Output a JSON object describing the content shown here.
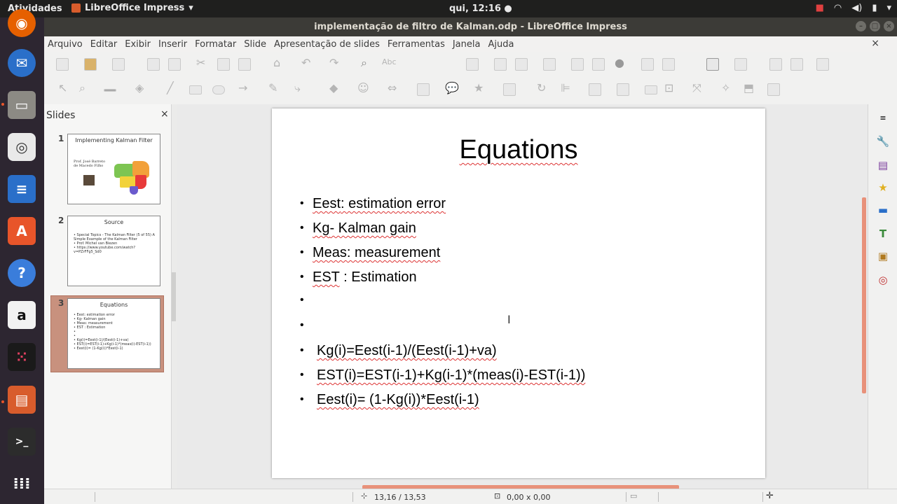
{
  "topbar": {
    "activities": "Atividades",
    "app_menu": "LibreOffice Impress",
    "clock": "qui, 12:16 ●"
  },
  "window": {
    "title": "implementação de filtro de Kalman.odp - LibreOffice Impress"
  },
  "menu": [
    "Arquivo",
    "Editar",
    "Exibir",
    "Inserir",
    "Formatar",
    "Slide",
    "Apresentação de slides",
    "Ferramentas",
    "Janela",
    "Ajuda"
  ],
  "slides_pane": {
    "header": "Slides",
    "close": "×",
    "thumbnails": [
      {
        "num": "1",
        "title": "Implementing Kalman Filter",
        "lines": [
          "Prof. José Barreto",
          "de Macedo Filho"
        ]
      },
      {
        "num": "2",
        "title": "Source",
        "lines": [
          "• Special Topics - The Kalman Filter (5 of 55) A",
          "  Simple Example of the Kalman Filter",
          "• Prof. Michel van Biezen",
          "• https://www.youtube.com/watch?",
          "  v=PZrFFg5_Sd0"
        ]
      },
      {
        "num": "3",
        "title": "Equations",
        "lines": [
          "• Eest: estimation error",
          "• Kg- Kalman gain",
          "• Meas: measurement",
          "• EST : Estimation",
          "•",
          "•",
          "• Kg(i)=Eest(i-1)/(Eest(i-1)+va)",
          "• EST(i)=EST(i-1)+Kg(i-1)*(meas(i)-EST(i-1))",
          "• Eest(i)= (1-Kg(i))*Eest(i-1)"
        ]
      }
    ]
  },
  "slide": {
    "title": "Equations",
    "bullets": [
      {
        "a": "Eest",
        "b": ": estimation error"
      },
      {
        "a": "Kg",
        "b": "- Kalman gain"
      },
      {
        "a": "Meas",
        "b": ": measurement"
      },
      {
        "a": "EST",
        "b": " : Estimation"
      }
    ],
    "equations": [
      "Kg(i)=Eest(i-1)/(Eest(i-1)+va)",
      "EST(i)=EST(i-1)+Kg(i-1)*(meas(i)-EST(i-1))",
      "Eest(i)= (1-Kg(i))*Eest(i-1)"
    ]
  },
  "statusbar": {
    "position": "13,16 / 13,53",
    "size": "0,00 x 0,00"
  },
  "colors": {
    "accent": "#e8917a",
    "dock_bg": "#2d2631",
    "titlebar_bg": "#3c3b37"
  }
}
